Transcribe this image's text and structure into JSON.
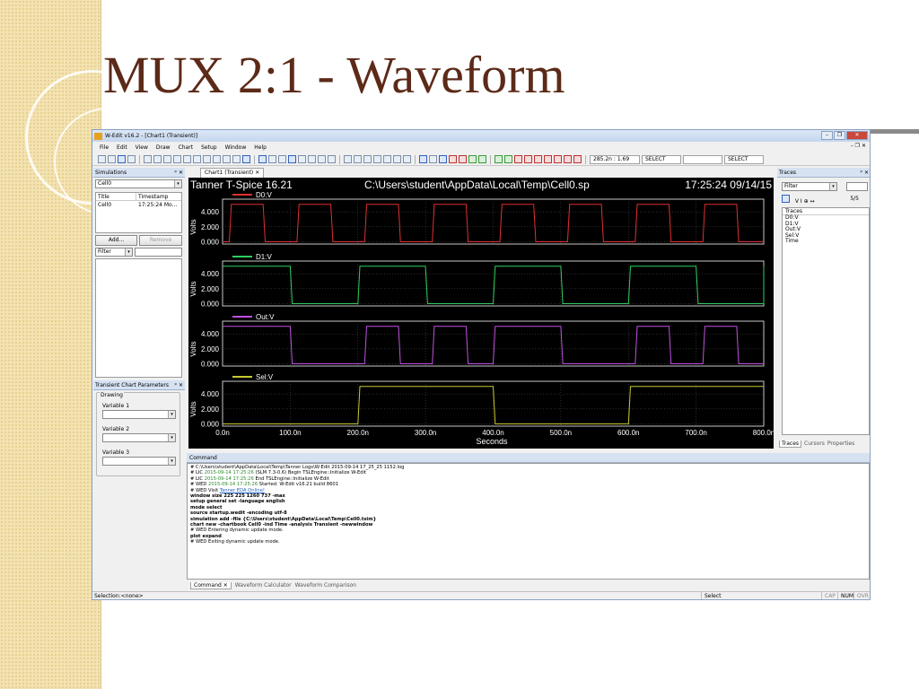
{
  "slide": {
    "title": "MUX 2:1 - Waveform"
  },
  "window": {
    "title": "W-Edit v16.2 - [Chart1 (Transient)]",
    "menu": [
      "File",
      "Edit",
      "View",
      "Draw",
      "Chart",
      "Setup",
      "Window",
      "Help"
    ],
    "controls": {
      "minimize": "–",
      "restore": "❐",
      "close": "✕"
    },
    "mdi_controls": "– ❐ ✕"
  },
  "toolbar": {
    "coord_readout": "285.2n : 1.69",
    "select_label_1": "SELECT",
    "select_label_2": "SELECT"
  },
  "simulations_panel": {
    "title": "Simulations",
    "header_buttons": "ᵖ ✕",
    "combo_value": "Cell0",
    "columns": [
      "Title",
      "Timestamp"
    ],
    "rows": [
      {
        "title": "Cell0",
        "timestamp": "17:25:24 Mo..."
      }
    ],
    "add_label": "Add...",
    "remove_label": "Remove",
    "filter_label": "Filter"
  },
  "params_panel": {
    "title": "Transient Chart Parameters",
    "header_buttons": "ᵖ ✕",
    "group_label": "Drawing",
    "variables": [
      "Variable 1",
      "Variable 2",
      "Variable 3"
    ]
  },
  "chart_tab": {
    "label": "Chart1 (Transient)",
    "close": "✕"
  },
  "chart_data": {
    "type": "line",
    "header_left": "Tanner T-Spice 16.21",
    "header_path": "C:\\Users\\student\\AppData\\Local\\Temp\\Cell0.sp",
    "header_time": "17:25:24 09/14/15",
    "xlabel": "Seconds",
    "ylabel": "Volts",
    "xlim": [
      0,
      800
    ],
    "x_tick_labels": [
      "0.0n",
      "100.0n",
      "200.0n",
      "300.0n",
      "400.0n",
      "500.0n",
      "600.0n",
      "700.0n",
      "800.0n"
    ],
    "x_ticks": [
      0,
      100,
      200,
      300,
      400,
      500,
      600,
      700,
      800
    ],
    "ylim": [
      -0.3,
      5.7
    ],
    "y_tick_labels": [
      "4.000",
      "2.000",
      "0.000"
    ],
    "y_ticks": [
      4,
      2,
      0
    ],
    "series": [
      {
        "name": "D0:V",
        "color": "#e03030",
        "period": 100,
        "high_start": 10,
        "high_duration": 50,
        "level": 5
      },
      {
        "name": "D1:V",
        "color": "#2ecf5e",
        "period": 200,
        "high_start": 0,
        "high_duration": 100,
        "level": 5
      },
      {
        "name": "Out:V",
        "color": "#c050e0",
        "segments": [
          {
            "from": 0,
            "to": 200,
            "source": "D1"
          },
          {
            "from": 200,
            "to": 400,
            "source": "D0"
          },
          {
            "from": 400,
            "to": 600,
            "source": "D1"
          },
          {
            "from": 600,
            "to": 800,
            "source": "D0"
          }
        ],
        "level": 5
      },
      {
        "name": "Sel:V",
        "color": "#c8c830",
        "transitions": [
          [
            0,
            0
          ],
          [
            200,
            0
          ],
          [
            200,
            5
          ],
          [
            400,
            5
          ],
          [
            400,
            0
          ],
          [
            600,
            0
          ],
          [
            600,
            5
          ],
          [
            800,
            5
          ]
        ],
        "level": 5
      }
    ]
  },
  "traces_panel": {
    "title": "Traces",
    "header_buttons": "ᵖ ✕",
    "filter_label": "Filter",
    "toolbar_text": "V  I  ⊕  ↔",
    "count": "5/5",
    "list_header": "Traces",
    "items": [
      "D0:V",
      "D1:V",
      "Out:V",
      "Sel:V",
      "Time"
    ],
    "tabs": [
      "Traces",
      "Cursors",
      "Properties"
    ]
  },
  "command_panel": {
    "title": "Command",
    "lines": [
      {
        "prefix": "# C:\\Users\\student\\AppData\\Local\\Temp\\Tanner Logs\\W-Edit 2015-09-14 17_25_25 1152.log",
        "ts": "",
        "text": "",
        "bold": false
      },
      {
        "prefix": "# LIC",
        "ts": "2015-09-14 17:25:26",
        "text": "(SLM 7.3-0.6) Begin TSLEngine::Initialize W-Edit",
        "bold": false
      },
      {
        "prefix": "# LIC",
        "ts": "2015-09-14 17:25:26",
        "text": "End TSLEngine::Initialize W-Edit",
        "bold": false
      },
      {
        "prefix": "# WED",
        "ts": "2015-09-14 17:25:26",
        "text": "Started: W-Edit v16.21 build 8601",
        "bold": false
      },
      {
        "prefix": "# WED  Visit",
        "ts": "",
        "text": "Tanner EDA Online!",
        "bold": false,
        "link": true
      },
      {
        "prefix": "",
        "ts": "",
        "text": "window size 225 225 1260 737 -max",
        "bold": true
      },
      {
        "prefix": "",
        "ts": "",
        "text": "setup general set -language english",
        "bold": true
      },
      {
        "prefix": "",
        "ts": "",
        "text": "mode select",
        "bold": true
      },
      {
        "prefix": "",
        "ts": "",
        "text": "source startup.wedit -encoding utf-8",
        "bold": true
      },
      {
        "prefix": "",
        "ts": "",
        "text": "simulation add -file {C:\\Users\\student\\AppData\\Local\\Temp\\Cell0.tsim}",
        "bold": true
      },
      {
        "prefix": "",
        "ts": "",
        "text": "chart new -chartbook Cell0 -ind Time -analysis Transient -newwindow",
        "bold": true
      },
      {
        "prefix": "# WED  Entering dynamic update mode.",
        "ts": "",
        "text": "",
        "bold": false
      },
      {
        "prefix": "",
        "ts": "",
        "text": "plot expand",
        "bold": true
      },
      {
        "prefix": "# WED  Exiting dynamic update mode.",
        "ts": "",
        "text": "",
        "bold": false
      }
    ],
    "tabs": [
      "Command",
      "Waveform Calculator",
      "Waveform Comparison"
    ],
    "close": "✕"
  },
  "statusbar": {
    "left": "Selection:<none>",
    "mode": "Select",
    "caps": "CAP",
    "num": "NUM",
    "ovr": "OVR"
  }
}
